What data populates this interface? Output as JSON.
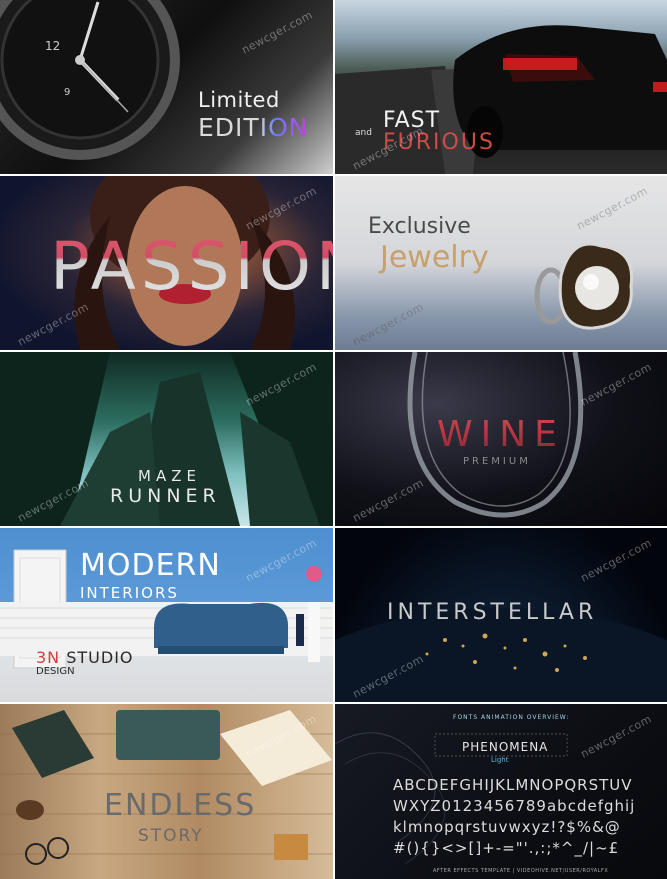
{
  "watermark": "newcger.com",
  "tiles": {
    "limited_edition": {
      "line1": "Limited",
      "line2": "EDITION"
    },
    "fast_furious": {
      "and": "and",
      "fast": "FAST",
      "furious": "FURIOUS"
    },
    "passion": {
      "title": "PASSION"
    },
    "jewelry": {
      "line1": "Exclusive",
      "line2": "Jewelry"
    },
    "maze_runner": {
      "line1": "MAZE",
      "line2": "RUNNER"
    },
    "wine": {
      "title": "WINE",
      "sub": "PREMIUM"
    },
    "modern_interiors": {
      "title": "MODERN",
      "sub": "INTERIORS",
      "studio_mark": "3N",
      "studio": "STUDIO",
      "design": "DESIGN"
    },
    "interstellar": {
      "title": "INTERSTELLAR"
    },
    "endless_story": {
      "line1": "ENDLESS",
      "line2": "STORY"
    },
    "font_overview": {
      "heading": "FONTS ANIMATION OVERVIEW:",
      "font_name": "PHENOMENA",
      "weight": "Light",
      "rows": [
        "ABCDEFGHIJKLMNOPQRSTUV",
        "WXYZ0123456789abcdefghij",
        "klmnopqrstuvwxyz!?$%&@",
        "#(){}<>[]+-=\"'.,:;*^_/|~£"
      ],
      "footer": "AFTER EFFECTS TEMPLATE  |  VIDEOHIVE.NET/USER/ROYALFX"
    }
  },
  "colors": {
    "passion_red": "#e05a70",
    "edition_purple": "#c040e0",
    "furious_red": "#d04a48",
    "jewelry_gold": "#c7a06a",
    "wine_red": "#d04850",
    "modern_blue": "#4f8fcf",
    "overview_cyan": "#9fd6e8"
  }
}
